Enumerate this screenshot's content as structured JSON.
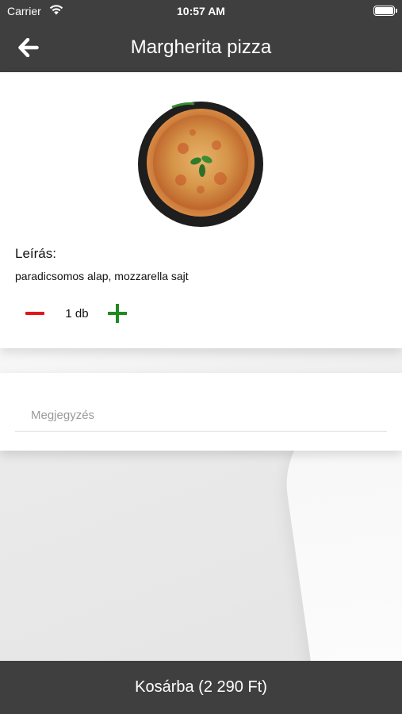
{
  "status_bar": {
    "carrier": "Carrier",
    "time": "10:57 AM"
  },
  "nav": {
    "title": "Margherita pizza",
    "back_icon": "arrow-left-icon"
  },
  "product": {
    "image_icon": "pizza-image",
    "description_label": "Leírás:",
    "description": "paradicsomos alap, mozzarella sajt",
    "quantity": "1 db"
  },
  "note": {
    "placeholder": "Megjegyzés",
    "value": ""
  },
  "cart_button": {
    "label": "Kosárba (2 290 Ft)"
  },
  "colors": {
    "bar": "#3f3f3f",
    "minus": "#e0161b",
    "plus": "#1f8a1f"
  }
}
